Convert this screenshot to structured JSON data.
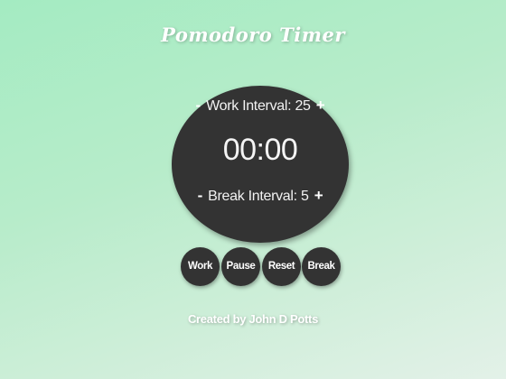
{
  "app": {
    "title": "Pomodoro Timer"
  },
  "timer": {
    "work_label": "Work Interval:",
    "work_value": "25",
    "break_label": "Break Interval:",
    "break_value": "5",
    "display": "00:00",
    "decrement_symbol": "-",
    "increment_symbol": "+"
  },
  "controls": {
    "work_label": "Work",
    "pause_label": "Pause",
    "reset_label": "Reset",
    "break_label": "Break"
  },
  "footer": {
    "credit": "Created by John D Potts"
  },
  "colors": {
    "background_start": "#a4ebc2",
    "background_end": "#e3f1e8",
    "dark": "#333333",
    "text_light": "#ffffff"
  }
}
